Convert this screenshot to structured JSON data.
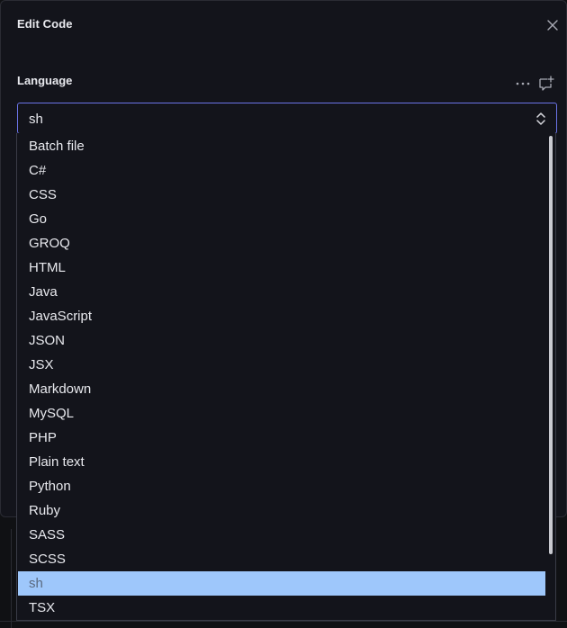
{
  "dialog": {
    "title": "Edit Code",
    "close_icon": "close-icon"
  },
  "field": {
    "label": "Language",
    "menu_icon": "ellipsis-icon",
    "comment_icon": "add-comment-icon"
  },
  "select": {
    "value": "sh",
    "chevron_icon": "chevron-up-down-icon"
  },
  "dropdown": {
    "selected_index": 18,
    "options": [
      "Batch file",
      "C#",
      "CSS",
      "Go",
      "GROQ",
      "HTML",
      "Java",
      "JavaScript",
      "JSON",
      "JSX",
      "Markdown",
      "MySQL",
      "PHP",
      "Plain text",
      "Python",
      "Ruby",
      "SASS",
      "SCSS",
      "sh",
      "TSX"
    ],
    "scroll_fraction_visible": 0.86
  },
  "colors": {
    "background": "#13141b",
    "focus_border": "#6b74e8",
    "selected_bg": "#9ec7fb",
    "text": "#e8e9ee"
  }
}
